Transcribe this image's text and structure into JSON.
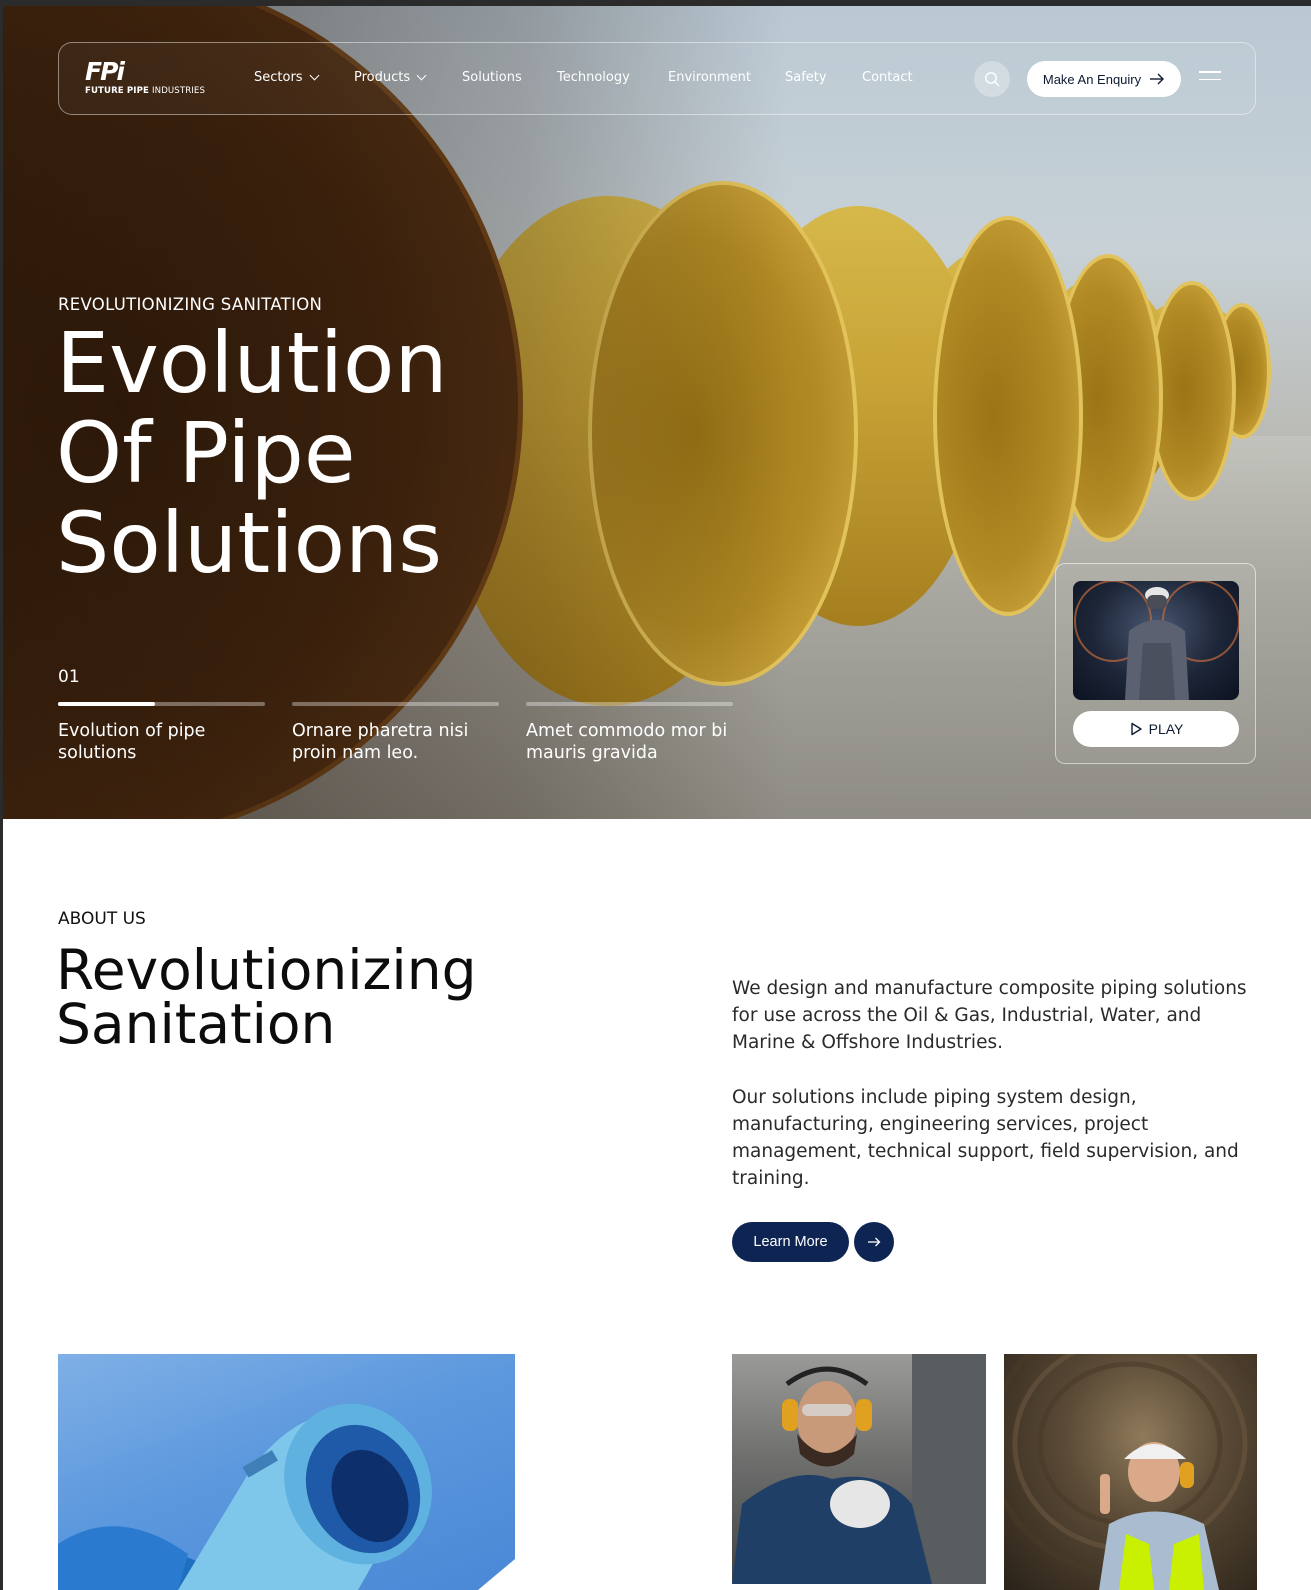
{
  "brand": {
    "logo_mark": "FPi",
    "logo_sub_bold": "FUTURE PIPE",
    "logo_sub_light": "INDUSTRIES"
  },
  "nav": {
    "items": [
      {
        "label": "Sectors",
        "has_dropdown": true
      },
      {
        "label": "Products",
        "has_dropdown": true
      },
      {
        "label": "Solutions",
        "has_dropdown": false
      },
      {
        "label": "Technology",
        "has_dropdown": false
      },
      {
        "label": "Environment",
        "has_dropdown": false
      },
      {
        "label": "Safety",
        "has_dropdown": false
      },
      {
        "label": "Contact",
        "has_dropdown": false
      }
    ],
    "search_icon": "search-icon",
    "enquiry_label": "Make An Enquiry",
    "menu_icon": "hamburger-menu-icon"
  },
  "hero": {
    "eyebrow": "REVOLUTIONIZING SANITATION",
    "title_lines": [
      "Evolution",
      "Of Pipe",
      "Solutions"
    ],
    "slide_number": "01",
    "slides": [
      {
        "text": "Evolution of pipe solutions",
        "progress": 0.47
      },
      {
        "text": "Ornare pharetra nisi proin nam leo.",
        "progress": 0
      },
      {
        "text": "Amet commodo mor bi mauris gravida",
        "progress": 0
      }
    ],
    "play_label": "PLAY"
  },
  "about": {
    "eyebrow": "ABOUT US",
    "title_lines": [
      "Revolutionizing",
      "Sanitation"
    ],
    "paragraph_1": "We design and manufacture composite piping solutions for use across the Oil & Gas, Industrial, Water, and Marine & Offshore Industries.",
    "paragraph_2": "Our solutions include piping system design, manufacturing, engineering services, project management, technical support, field supervision, and training.",
    "cta_label": "Learn More"
  },
  "colors": {
    "navy": "#0e2553",
    "accent_orange": "#e8791e",
    "pipe_yellow": "#c9a437"
  }
}
